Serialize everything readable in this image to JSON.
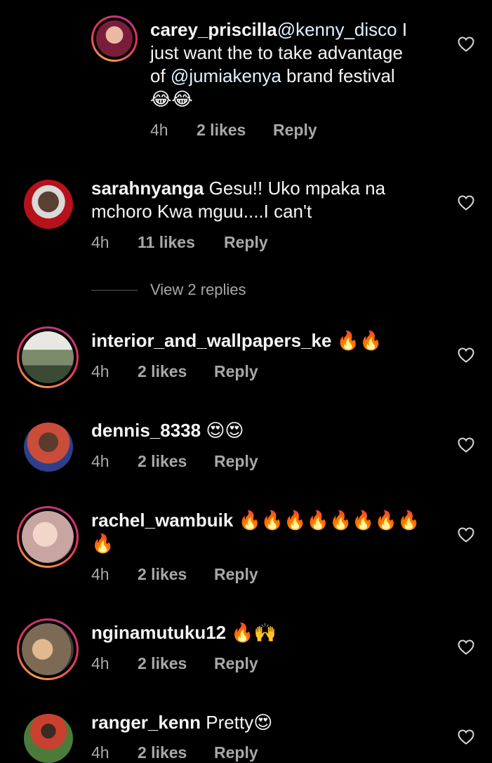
{
  "comments": [
    {
      "username": "carey_priscilla",
      "mention": "@kenny_disco",
      "text1": " I",
      "text2": "just want the to take advantage",
      "text3_pre": "of ",
      "mention2": "@jumiakenya",
      "text3_post": " brand festival",
      "emoji": "😂😂",
      "time": "4h",
      "likes": "2 likes",
      "reply": "Reply",
      "avatar_color": "#d8a38b"
    },
    {
      "username": "sarahnyanga",
      "text1": " Gesu!! Uko mpaka na",
      "text2": "mchoro Kwa mguu....I can't",
      "time": "4h",
      "likes": "11 likes",
      "reply": "Reply",
      "avatar_color": "#b5121b"
    },
    {
      "username": "interior_and_wallpapers_ke",
      "emoji": " 🔥🔥",
      "time": "4h",
      "likes": "2 likes",
      "reply": "Reply",
      "avatar_color": "#6e7f60"
    },
    {
      "username": "dennis_8338",
      "emoji": " 😍😍",
      "time": "4h",
      "likes": "2 likes",
      "reply": "Reply",
      "avatar_color": "#c94d3a"
    },
    {
      "username": "rachel_wambuik",
      "emoji": " 🔥🔥🔥🔥🔥🔥🔥🔥",
      "emoji2": "🔥",
      "time": "4h",
      "likes": "2 likes",
      "reply": "Reply",
      "avatar_color": "#c9a5a2"
    },
    {
      "username": "nginamutuku12",
      "emoji": " 🔥🙌",
      "time": "4h",
      "likes": "2 likes",
      "reply": "Reply",
      "avatar_color": "#7d6a55"
    },
    {
      "username": "ranger_kenn",
      "text1": " Pretty",
      "emoji": "😍",
      "time": "4h",
      "likes": "2 likes",
      "reply": "Reply",
      "avatar_color": "#4c7a3b"
    }
  ],
  "view_replies": "View 2 replies",
  "colors": {
    "background": "#000000",
    "text": "#f5f5f5",
    "muted": "#a8a8a8",
    "mention": "#e0f1ff"
  }
}
